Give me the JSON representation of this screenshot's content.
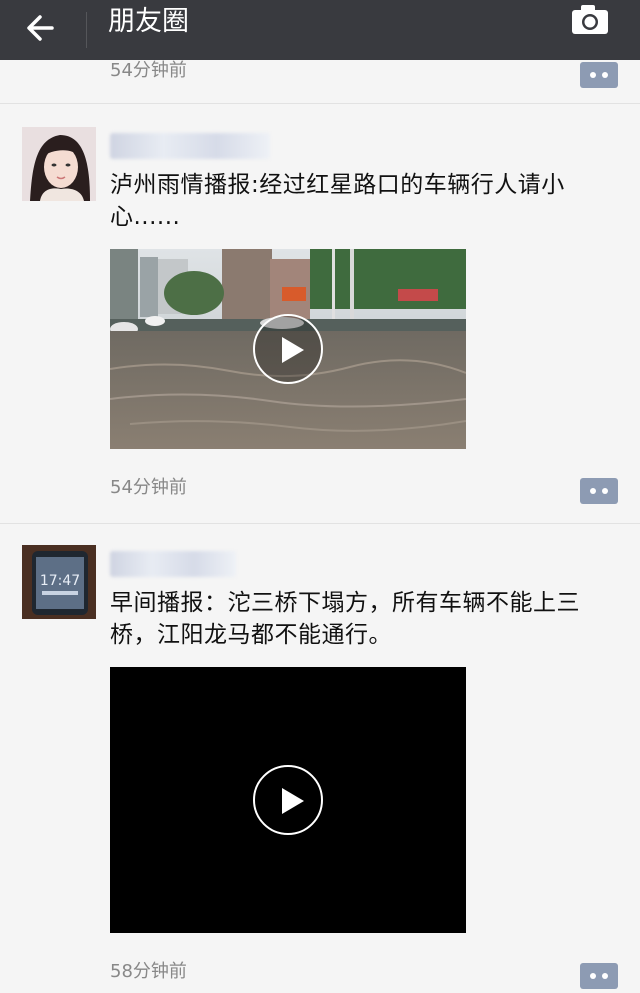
{
  "topbar": {
    "title": "朋友圈",
    "back_icon": "arrow-left-icon",
    "camera_icon": "camera-icon"
  },
  "partial_post": {
    "timestamp": "54分钟前"
  },
  "posts": [
    {
      "text": "泸州雨情播报:经过红星路口的车辆行人请小心......",
      "timestamp": "54分钟前",
      "video": "flooded-street-video"
    },
    {
      "text": "早间播报：沱三桥下塌方，所有车辆不能上三桥，江阳龙马都不能通行。",
      "timestamp": "58分钟前",
      "video": "black-video"
    }
  ],
  "colors": {
    "topbar": "#393a3f",
    "background": "#f5f5f5",
    "comment_button": "#8d9bb3",
    "timestamp": "#888888"
  }
}
